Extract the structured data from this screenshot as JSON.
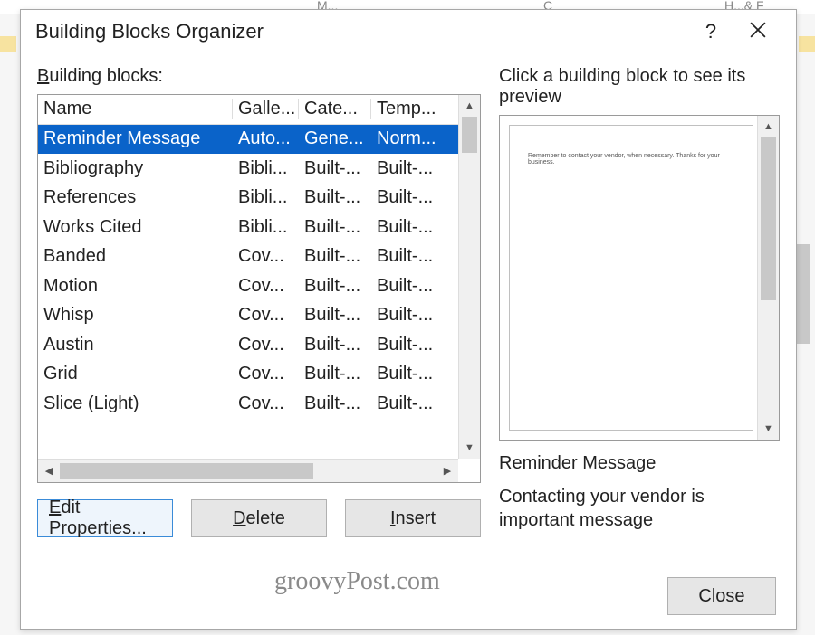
{
  "background": {
    "ribbon_tab_1": "M...",
    "ribbon_tab_2": "C",
    "ribbon_tab_3": "H...& F"
  },
  "dialog": {
    "title": "Building Blocks Organizer",
    "help_symbol": "?",
    "left_label": "Building blocks:",
    "columns": {
      "name": "Name",
      "gallery": "Galle...",
      "category": "Cate...",
      "template": "Temp..."
    },
    "rows": [
      {
        "name": "Reminder Message",
        "gallery": "Auto...",
        "category": "Gene...",
        "template": "Norm...",
        "selected": true
      },
      {
        "name": "Bibliography",
        "gallery": "Bibli...",
        "category": "Built-...",
        "template": "Built-..."
      },
      {
        "name": "References",
        "gallery": "Bibli...",
        "category": "Built-...",
        "template": "Built-..."
      },
      {
        "name": "Works Cited",
        "gallery": "Bibli...",
        "category": "Built-...",
        "template": "Built-..."
      },
      {
        "name": "Banded",
        "gallery": "Cov...",
        "category": "Built-...",
        "template": "Built-..."
      },
      {
        "name": "Motion",
        "gallery": "Cov...",
        "category": "Built-...",
        "template": "Built-..."
      },
      {
        "name": "Whisp",
        "gallery": "Cov...",
        "category": "Built-...",
        "template": "Built-..."
      },
      {
        "name": "Austin",
        "gallery": "Cov...",
        "category": "Built-...",
        "template": "Built-..."
      },
      {
        "name": "Grid",
        "gallery": "Cov...",
        "category": "Built-...",
        "template": "Built-..."
      },
      {
        "name": "Slice (Light)",
        "gallery": "Cov...",
        "category": "Built-...",
        "template": "Built-..."
      }
    ],
    "buttons": {
      "edit": "Edit Properties...",
      "delete": "Delete",
      "insert": "Insert",
      "close": "Close"
    },
    "preview_label": "Click a building block to see its preview",
    "preview_page_text": "Remember to contact your vendor, when necessary. Thanks for your business.",
    "preview_name": "Reminder Message",
    "preview_desc": "Contacting your vendor is important message"
  },
  "watermark": "groovyPost.com"
}
